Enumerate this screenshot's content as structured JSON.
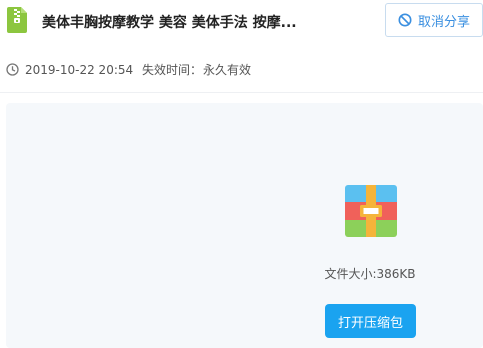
{
  "header": {
    "file_icon": "zip-file-icon",
    "title": "美体丰胸按摩教学 美容 美体手法 按摩...",
    "cancel_share_label": "取消分享",
    "cancel_icon": "ban-icon"
  },
  "meta": {
    "clock_icon": "clock-icon",
    "share_time": "2019-10-22 20:54",
    "expire_label": "失效时间：",
    "expire_value": "永久有效"
  },
  "preview": {
    "archive_icon": "archive-icon",
    "size_label": "文件大小:",
    "size_value": "386KB",
    "open_button_label": "打开压缩包"
  },
  "colors": {
    "accent": "#1aa3f0",
    "link_blue": "#3a8fe0",
    "file_icon_green": "#8cc63f",
    "panel_bg": "#f5f8fb"
  }
}
